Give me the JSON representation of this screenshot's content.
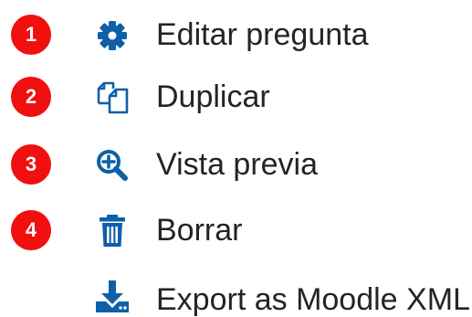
{
  "colors": {
    "icon": "#0f5fa8",
    "badge": "#f01010",
    "text": "#222426"
  },
  "menu": {
    "items": [
      {
        "badge": "1",
        "icon": "gear-icon",
        "label": "Editar pregunta"
      },
      {
        "badge": "2",
        "icon": "duplicate-icon",
        "label": "Duplicar"
      },
      {
        "badge": "3",
        "icon": "zoom-in-icon",
        "label": "Vista previa"
      },
      {
        "badge": "4",
        "icon": "trash-icon",
        "label": "Borrar"
      },
      {
        "icon": "download-icon",
        "label": "Export as Moodle XML"
      }
    ]
  }
}
